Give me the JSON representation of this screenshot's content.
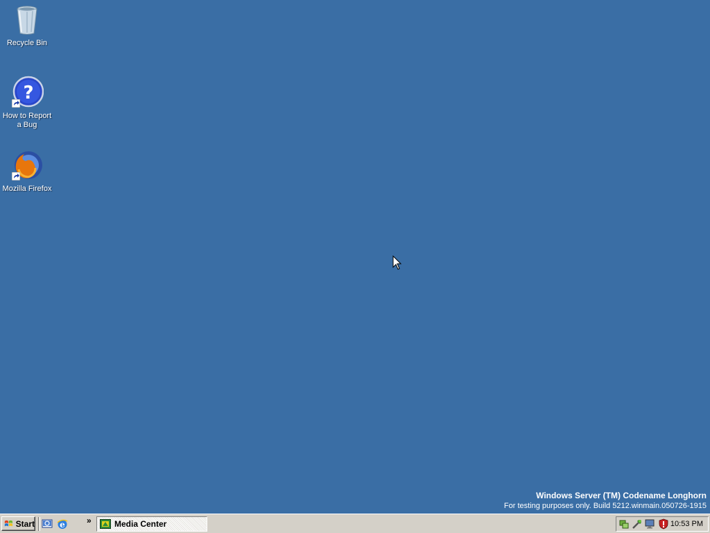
{
  "desktop": {
    "background": "#3a6ea5",
    "icons": [
      {
        "label": "Recycle Bin",
        "icon": "recycle-bin-icon"
      },
      {
        "label": "How to Report\na Bug",
        "icon": "help-icon"
      },
      {
        "label": "Mozilla Firefox",
        "icon": "firefox-icon"
      }
    ],
    "watermark": {
      "line1": "Windows Server (TM) Codename Longhorn",
      "line2": "For testing purposes only. Build 5212.winmain.050726-1915"
    }
  },
  "taskbar": {
    "start_label": "Start",
    "quick_launch": [
      {
        "icon": "show-desktop-icon"
      },
      {
        "icon": "internet-explorer-icon"
      }
    ],
    "overflow_chevron": "»",
    "tasks": [
      {
        "label": "Media Center",
        "icon": "media-center-icon",
        "active": true
      }
    ],
    "tray": {
      "icons": [
        "network-icon",
        "tools-icon",
        "display-icon",
        "security-shield-icon"
      ],
      "clock": "10:53 PM"
    }
  }
}
